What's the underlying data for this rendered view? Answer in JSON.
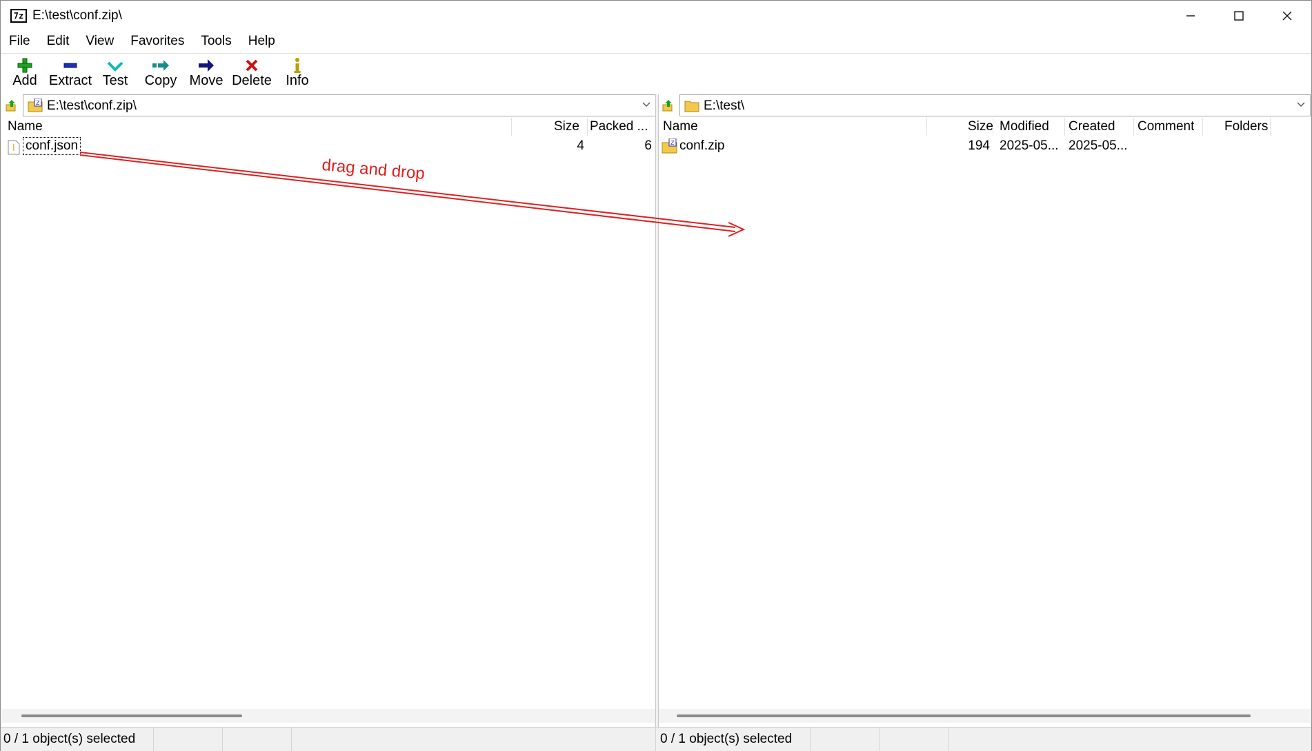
{
  "window": {
    "title": "E:\\test\\conf.zip\\",
    "app_icon_text": "7z",
    "controls": {
      "minimize_icon": "minimize-icon",
      "maximize_icon": "maximize-icon",
      "close_icon": "close-icon"
    }
  },
  "menu": {
    "items": [
      "File",
      "Edit",
      "View",
      "Favorites",
      "Tools",
      "Help"
    ]
  },
  "toolbar": {
    "buttons": [
      {
        "label": "Add",
        "icon": "plus-icon",
        "color": "#1aa31a"
      },
      {
        "label": "Extract",
        "icon": "minus-icon",
        "color": "#1a2fb8"
      },
      {
        "label": "Test",
        "icon": "check-icon",
        "color": "#10b8b8"
      },
      {
        "label": "Copy",
        "icon": "double-arrow-icon",
        "color": "#1a8a8a"
      },
      {
        "label": "Move",
        "icon": "arrow-right-icon",
        "color": "#14147a"
      },
      {
        "label": "Delete",
        "icon": "x-icon",
        "color": "#d01010"
      },
      {
        "label": "Info",
        "icon": "info-icon",
        "color": "#b8a000"
      }
    ]
  },
  "left_pane": {
    "path": "E:\\test\\conf.zip\\",
    "columns": [
      "Name",
      "Size",
      "Packed ..."
    ],
    "rows": [
      {
        "name": "conf.json",
        "size": "4",
        "packed": "6"
      }
    ],
    "status": "0 / 1 object(s) selected",
    "scroll_fraction": 0.36
  },
  "right_pane": {
    "path": "E:\\test\\",
    "columns": [
      "Name",
      "Size",
      "Modified",
      "Created",
      "Comment",
      "Folders"
    ],
    "rows": [
      {
        "name": "conf.zip",
        "size": "194",
        "modified": "2025-05...",
        "created": "2025-05...",
        "comment": "",
        "folders": ""
      }
    ],
    "status": "0 / 1 object(s) selected",
    "scroll_fraction": 0.94
  },
  "annotation": {
    "label": "drag and drop",
    "color": "#e02020"
  }
}
